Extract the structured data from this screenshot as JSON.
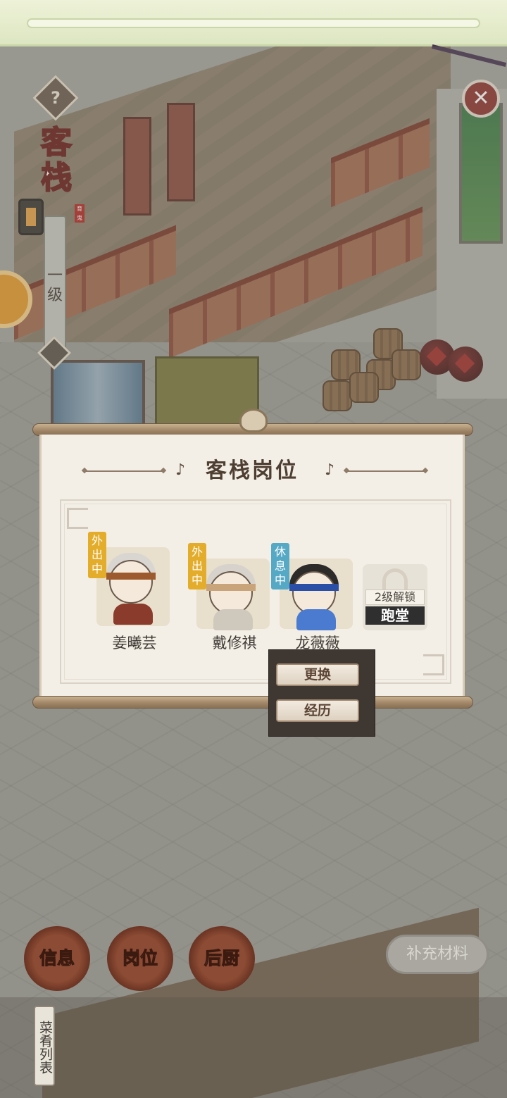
{
  "inn": {
    "title": "客栈",
    "seal_text": "育鬼",
    "level": "一级",
    "help_icon": "?"
  },
  "panel": {
    "title": "客栈岗位"
  },
  "staff": [
    {
      "name": "姜曦芸",
      "status": "外出中",
      "status_color": "#e4ac2b",
      "hair": "#d9d6d2",
      "band": "#9c5a2e",
      "body": "#8a3b2c"
    },
    {
      "name": "戴修祺",
      "status": "外出中",
      "status_color": "#e4ac2b",
      "hair": "#d7d3cc",
      "band": "#c9a37a",
      "body": "#cfc8bc"
    },
    {
      "name": "龙薇薇",
      "status": "休息中",
      "status_color": "#56a9c5",
      "hair": "#2d2a2a",
      "band": "#2b4fa6",
      "body": "#4a7bd1"
    }
  ],
  "locked_slot": {
    "unlock_text": "2级解锁",
    "role": "跑堂"
  },
  "popup": {
    "replace_label": "更换",
    "history_label": "经历"
  },
  "bottom_nav": {
    "info_label": "信息",
    "post_label": "岗位",
    "kitchen_label": "后厨",
    "supply_label": "补充材料",
    "menu_list_label": "菜肴列表"
  },
  "close_icon": "✕"
}
